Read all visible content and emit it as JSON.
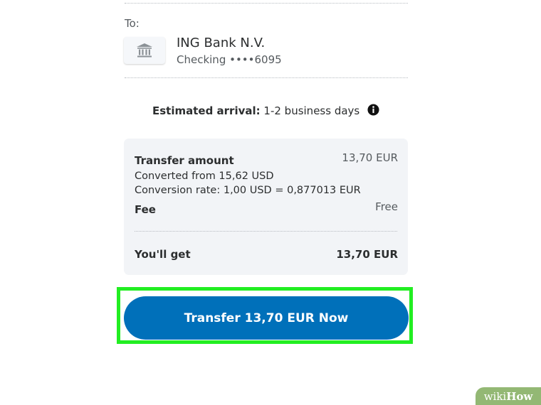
{
  "recipient": {
    "to_label": "To:",
    "bank_icon": "bank-building-icon",
    "bank_name": "ING Bank N.V.",
    "account": "Checking ••••6095"
  },
  "arrival": {
    "label": "Estimated arrival:",
    "value": "1-2 business days",
    "info_icon": "info-icon"
  },
  "summary": {
    "transfer_amount_label": "Transfer amount",
    "transfer_amount_value": "13,70 EUR",
    "converted_from": "Converted from 15,62 USD",
    "conversion_rate": "Conversion rate: 1,00 USD = 0,877013 EUR",
    "fee_label": "Fee",
    "fee_value": "Free",
    "you_get_label": "You'll get",
    "you_get_value": "13,70 EUR"
  },
  "action": {
    "button_label": "Transfer 13,70 EUR Now"
  },
  "watermark": {
    "wiki": "wiki",
    "how": "How"
  },
  "colors": {
    "button": "#0070ba",
    "highlight": "#22ee22",
    "summary_bg": "#f2f4f7",
    "watermark_bg": "#93b874"
  }
}
